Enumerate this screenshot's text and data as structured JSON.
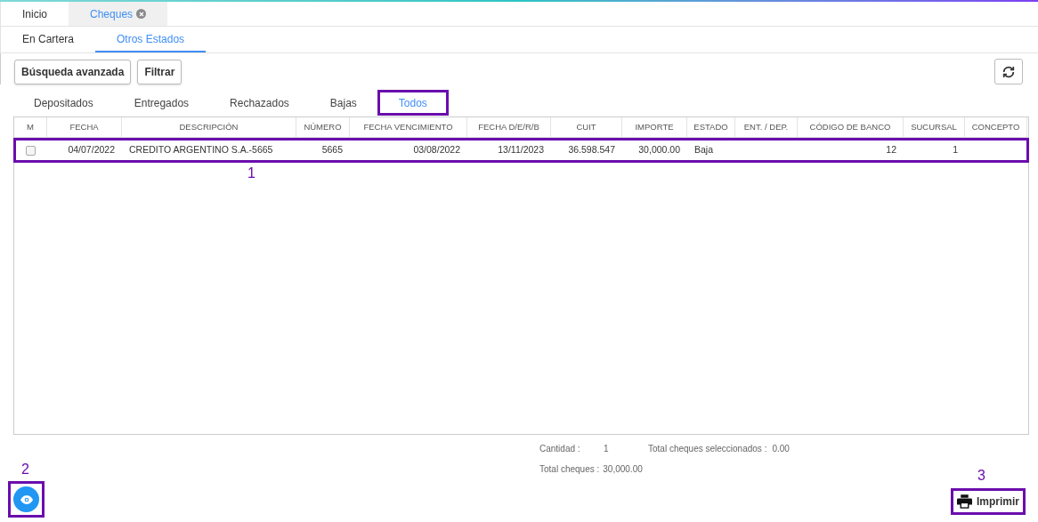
{
  "page_tabs": [
    {
      "label": "Inicio",
      "selected": false,
      "closable": false
    },
    {
      "label": "Cheques",
      "selected": true,
      "closable": true
    }
  ],
  "sub_tabs": [
    {
      "label": "En Cartera",
      "selected": false
    },
    {
      "label": "Otros Estados",
      "selected": true
    }
  ],
  "toolbar": {
    "buttons": [
      "Búsqueda avanzada",
      "Filtrar"
    ]
  },
  "state_tabs": [
    {
      "label": "Depositados",
      "selected": false,
      "highlighted": false
    },
    {
      "label": "Entregados",
      "selected": false,
      "highlighted": false
    },
    {
      "label": "Rechazados",
      "selected": false,
      "highlighted": false
    },
    {
      "label": "Bajas",
      "selected": false,
      "highlighted": false
    },
    {
      "label": "Todos",
      "selected": true,
      "highlighted": true
    }
  ],
  "table": {
    "columns": [
      "M",
      "FECHA",
      "DESCRIPCIÓN",
      "NÚMERO",
      "FECHA VENCIMIENTO",
      "FECHA D/E/R/B",
      "CUIT",
      "IMPORTE",
      "ESTADO",
      "ENT. / DEP.",
      "CÓDIGO DE BANCO",
      "SUCURSAL",
      "CONCEPTO"
    ],
    "rows": [
      {
        "checked": false,
        "highlighted": true,
        "callout": "1",
        "cells": [
          "",
          "04/07/2022",
          "CREDITO ARGENTINO S.A.-5665",
          "5665",
          "03/08/2022",
          "13/11/2023",
          "36.598.547",
          "30,000.00",
          "Baja",
          "",
          "12",
          "1",
          ""
        ]
      }
    ]
  },
  "summary": [
    {
      "label": "Cantidad :",
      "value": "1"
    },
    {
      "label": "Total cheques seleccionados :",
      "value": "0.00"
    },
    {
      "label": "Total cheques :",
      "value": "30,000.00"
    }
  ],
  "view_button": {
    "highlighted": true,
    "callout": "2"
  },
  "print_button": {
    "label": "Imprimir",
    "highlighted": true,
    "callout": "3"
  }
}
